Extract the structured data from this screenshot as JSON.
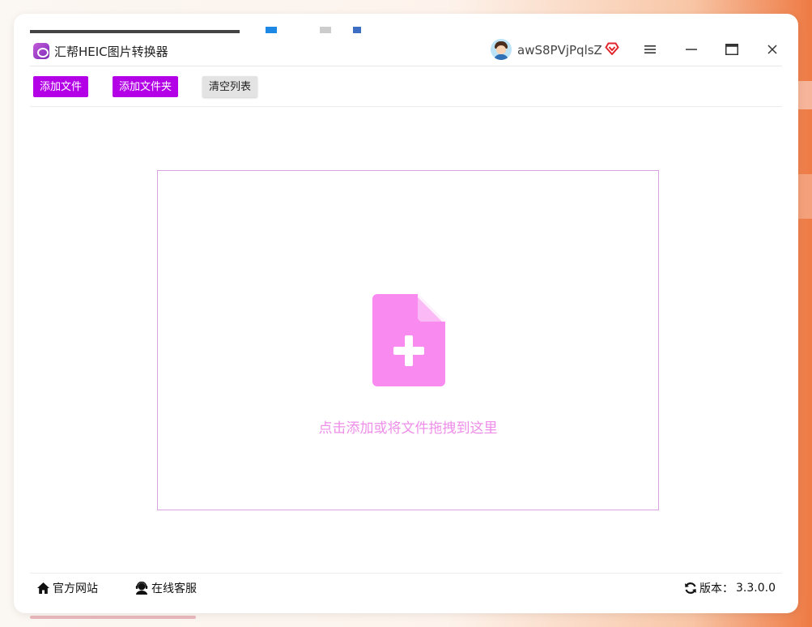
{
  "app": {
    "title": "汇帮HEIC图片转换器",
    "username": "awS8PVjPqlsZ"
  },
  "toolbar": {
    "add_file": "添加文件",
    "add_folder": "添加文件夹",
    "clear_list": "清空列表"
  },
  "dropzone": {
    "hint": "点击添加或将文件拖拽到这里"
  },
  "statusbar": {
    "official_site": "官方网站",
    "online_service": "在线客服",
    "version_label": "版本：",
    "version": "3.3.0.0"
  },
  "colors": {
    "accent": "#b300e6",
    "drop_icon": "#f98bf0",
    "drop_text": "#ee8ee8",
    "drop_border": "#d9a3de",
    "vip_icon": "#e0262d"
  }
}
